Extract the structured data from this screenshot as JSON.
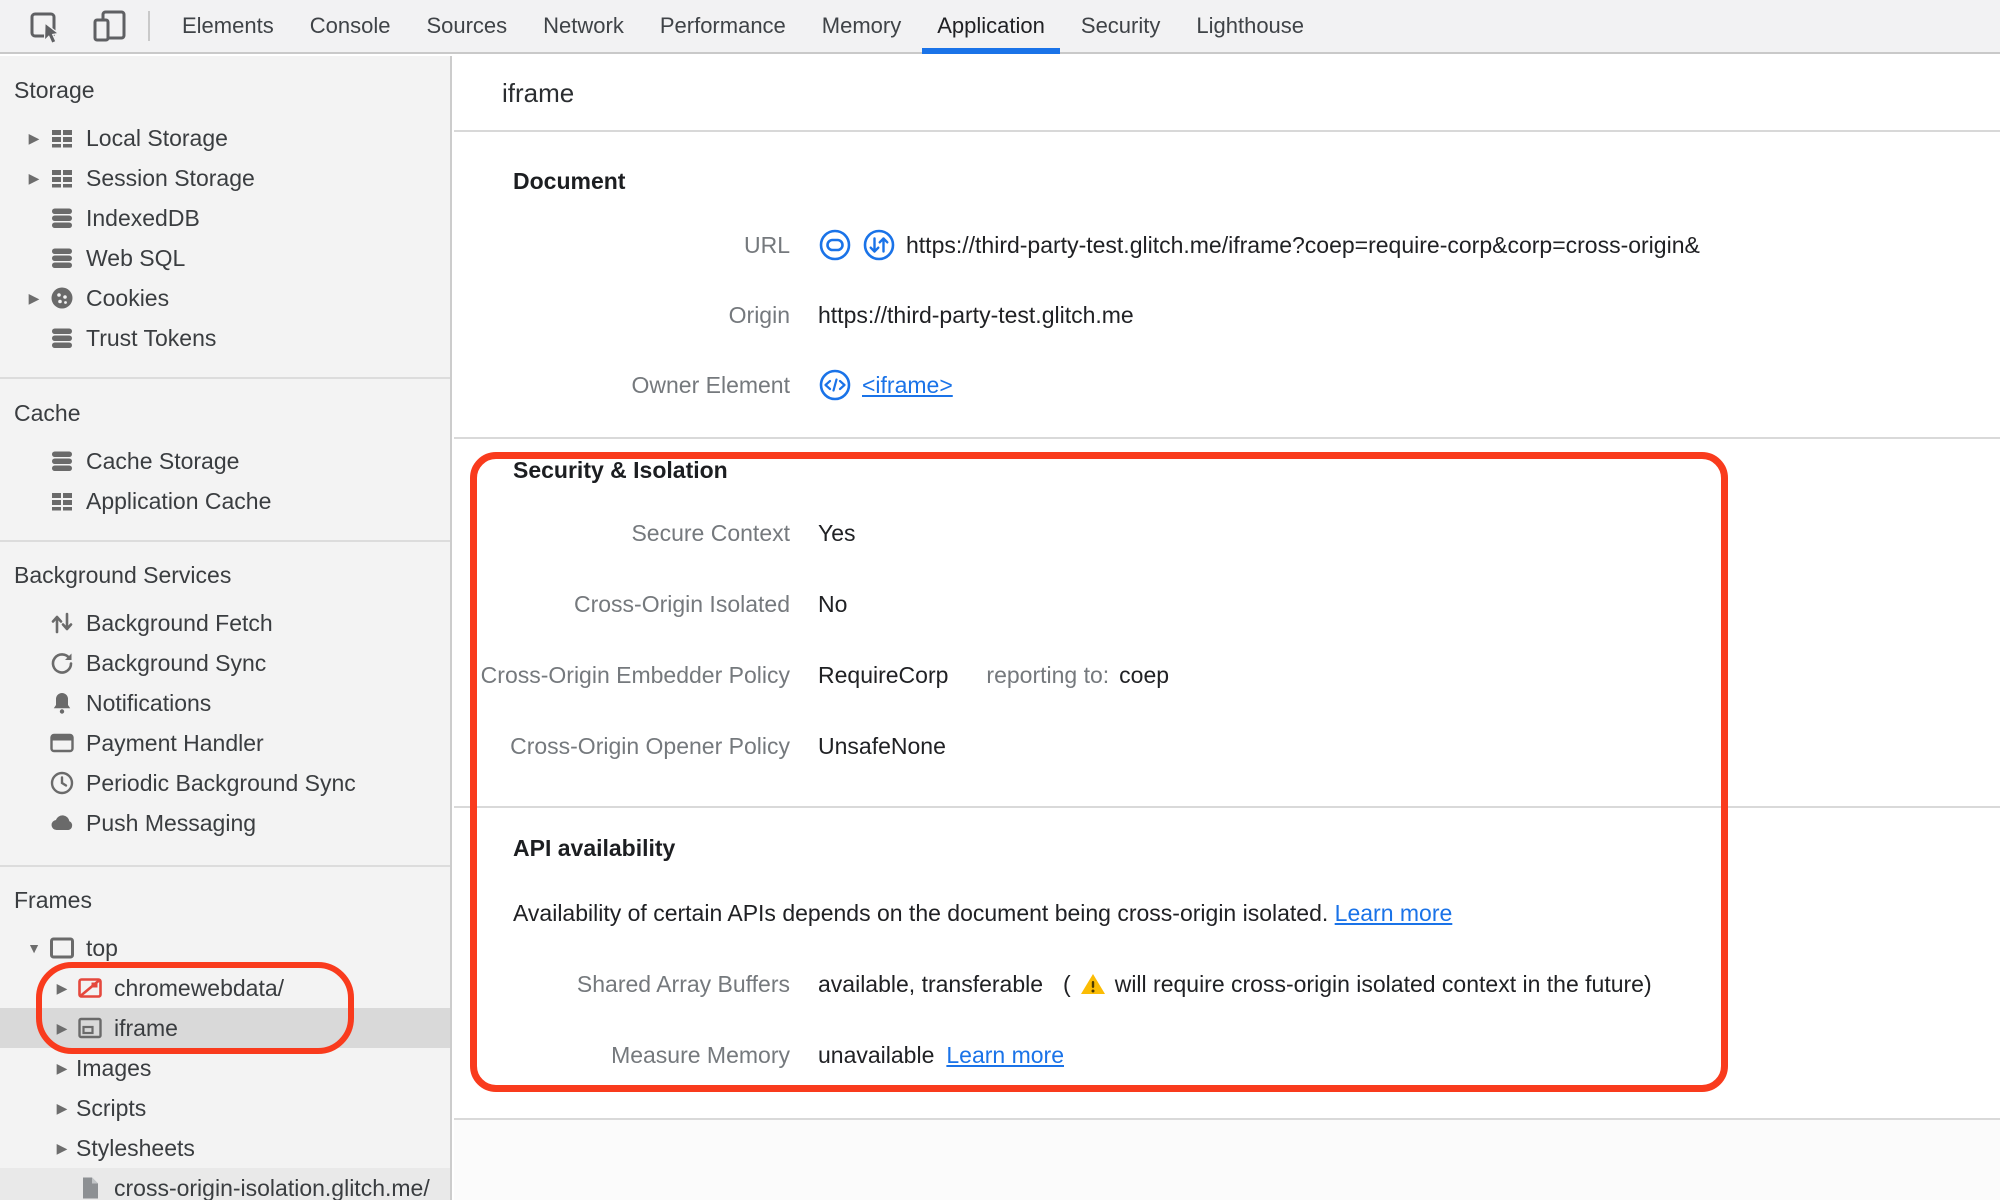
{
  "toolbar": {
    "tabs": [
      {
        "label": "Elements"
      },
      {
        "label": "Console"
      },
      {
        "label": "Sources"
      },
      {
        "label": "Network"
      },
      {
        "label": "Performance"
      },
      {
        "label": "Memory"
      },
      {
        "label": "Application"
      },
      {
        "label": "Security"
      },
      {
        "label": "Lighthouse"
      }
    ],
    "selected_tab": "Application"
  },
  "sidebar": {
    "sections": [
      {
        "title": "Storage",
        "items": [
          {
            "label": "Local Storage",
            "icon": "table-icon"
          },
          {
            "label": "Session Storage",
            "icon": "table-icon"
          },
          {
            "label": "IndexedDB",
            "icon": "database-icon"
          },
          {
            "label": "Web SQL",
            "icon": "database-icon"
          },
          {
            "label": "Cookies",
            "icon": "cookie-icon"
          },
          {
            "label": "Trust Tokens",
            "icon": "database-icon"
          }
        ]
      },
      {
        "title": "Cache",
        "items": [
          {
            "label": "Cache Storage",
            "icon": "database-icon"
          },
          {
            "label": "Application Cache",
            "icon": "table-icon"
          }
        ]
      },
      {
        "title": "Background Services",
        "items": [
          {
            "label": "Background Fetch",
            "icon": "fetch-arrows-icon"
          },
          {
            "label": "Background Sync",
            "icon": "sync-icon"
          },
          {
            "label": "Notifications",
            "icon": "bell-icon"
          },
          {
            "label": "Payment Handler",
            "icon": "card-icon"
          },
          {
            "label": "Periodic Background Sync",
            "icon": "clock-icon"
          },
          {
            "label": "Push Messaging",
            "icon": "cloud-icon"
          }
        ]
      },
      {
        "title": "Frames",
        "items": [
          {
            "label": "top",
            "icon": "window-icon",
            "expanded": true
          },
          {
            "label": "chromewebdata/",
            "icon": "frame-error-icon"
          },
          {
            "label": "iframe",
            "icon": "iframe-icon",
            "selected": true
          },
          {
            "label": "Images"
          },
          {
            "label": "Scripts"
          },
          {
            "label": "Stylesheets"
          },
          {
            "label": "cross-origin-isolation.glitch.me/",
            "icon": "document-icon"
          }
        ]
      }
    ]
  },
  "main": {
    "title": "iframe",
    "document_section": {
      "heading": "Document",
      "url_label": "URL",
      "url_value": "https://third-party-test.glitch.me/iframe?coep=require-corp&corp=cross-origin&",
      "origin_label": "Origin",
      "origin_value": "https://third-party-test.glitch.me",
      "owner_label": "Owner Element",
      "owner_link": "<iframe>"
    },
    "security_section": {
      "heading": "Security & Isolation",
      "rows": [
        {
          "label": "Secure Context",
          "value": "Yes"
        },
        {
          "label": "Cross-Origin Isolated",
          "value": "No"
        },
        {
          "label": "Cross-Origin Embedder Policy",
          "value": "RequireCorp",
          "note_label": "reporting to:",
          "note_value": "coep"
        },
        {
          "label": "Cross-Origin Opener Policy",
          "value": "UnsafeNone"
        }
      ]
    },
    "api_section": {
      "heading": "API availability",
      "description": "Availability of certain APIs depends on the document being cross-origin isolated.",
      "description_link": "Learn more",
      "sab_label": "Shared Array Buffers",
      "sab_value": "available, transferable",
      "sab_note_open": "(",
      "sab_note": "will require cross-origin isolated context in the future)",
      "mm_label": "Measure Memory",
      "mm_value": "unavailable",
      "mm_link": "Learn more"
    }
  },
  "colors": {
    "accent_blue": "#1a73e8",
    "annotation_red": "#f93b1d",
    "warning_yellow": "#fbbc04",
    "frame_error_red": "#e5483d"
  }
}
